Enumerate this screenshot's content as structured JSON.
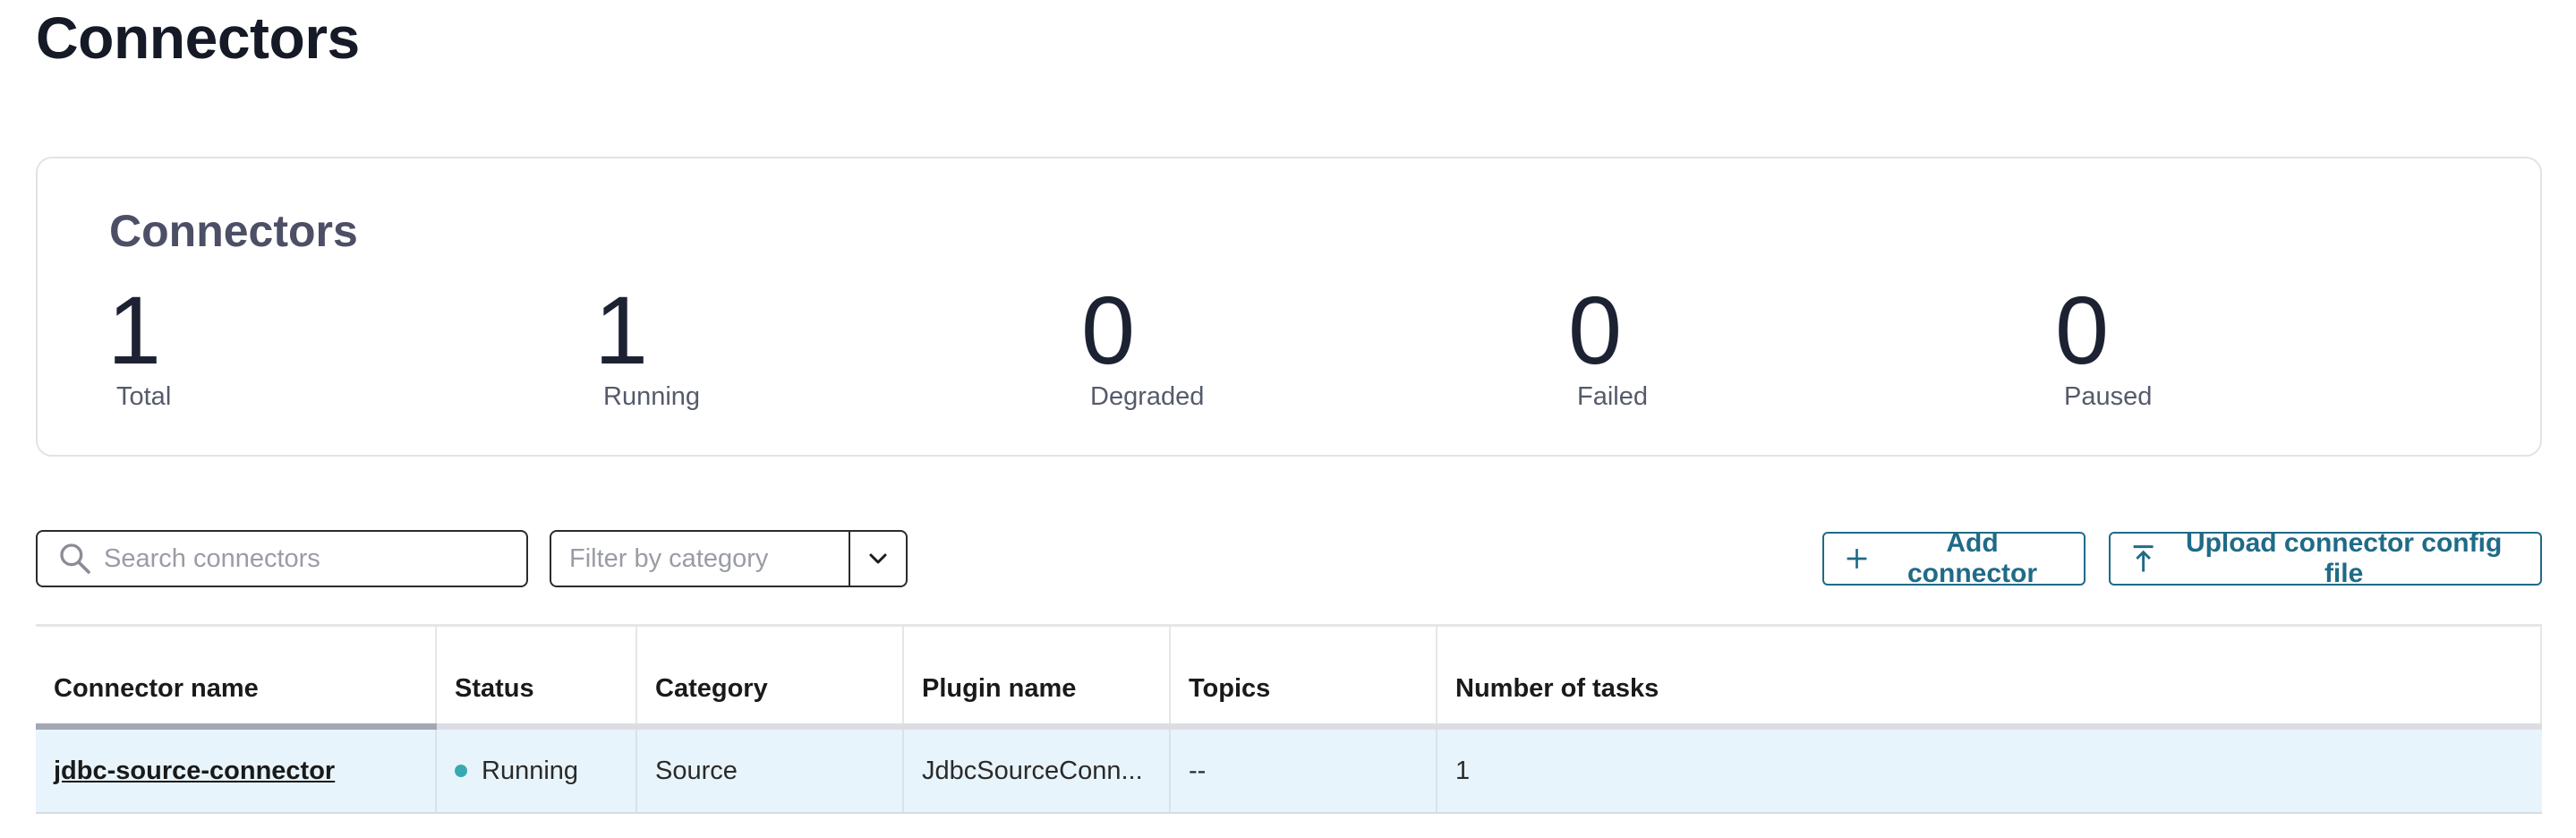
{
  "page": {
    "title": "Connectors"
  },
  "summary": {
    "title": "Connectors",
    "stats": [
      {
        "value": "1",
        "label": "Total"
      },
      {
        "value": "1",
        "label": "Running"
      },
      {
        "value": "0",
        "label": "Degraded"
      },
      {
        "value": "0",
        "label": "Failed"
      },
      {
        "value": "0",
        "label": "Paused"
      }
    ]
  },
  "toolbar": {
    "search_placeholder": "Search connectors",
    "filter_placeholder": "Filter by category",
    "add_label": "Add connector",
    "upload_label": "Upload connector config file"
  },
  "table": {
    "columns": [
      "Connector name",
      "Status",
      "Category",
      "Plugin name",
      "Topics",
      "Number of tasks"
    ],
    "rows": [
      {
        "name": "jdbc-source-connector",
        "status": "Running",
        "category": "Source",
        "plugin": "JdbcSourceConn...",
        "topics": "--",
        "tasks": "1"
      }
    ]
  },
  "colors": {
    "accent": "#1f6b87",
    "running": "#38a9b4",
    "row_highlight": "#e8f4fb"
  }
}
